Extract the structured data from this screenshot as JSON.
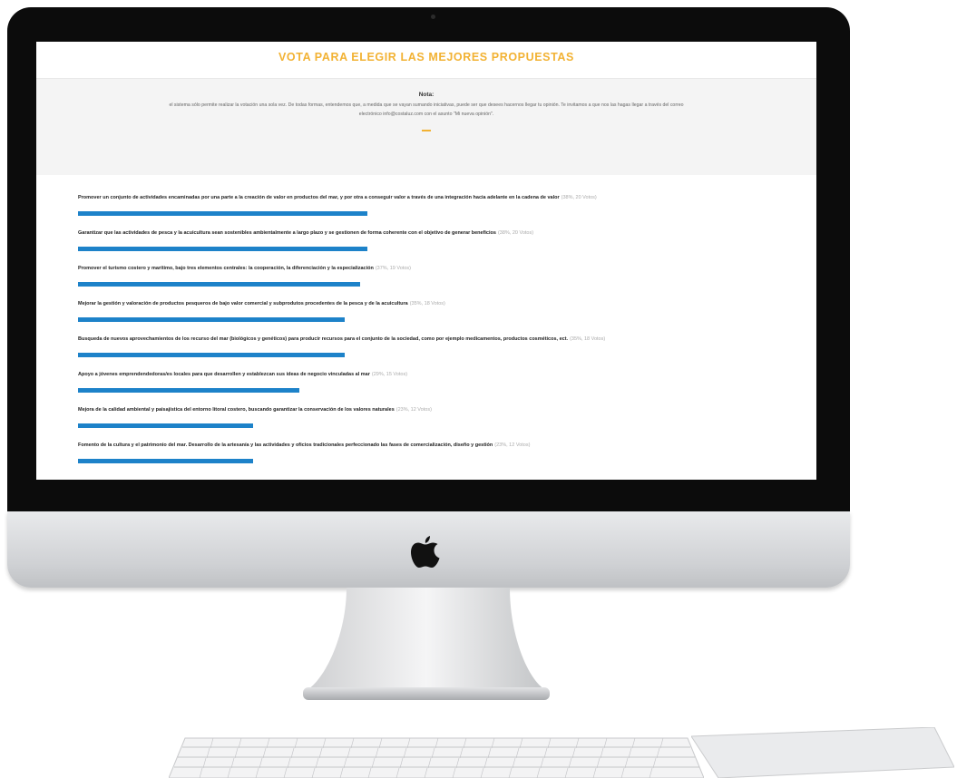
{
  "page": {
    "title": "VOTA PARA ELEGIR LAS MEJORES PROPUESTAS",
    "note": {
      "title": "Nota:",
      "text": "el sistema sólo permite realizar la votación una sola vez. De todas formas, entendemos que, a medida que se vayan sumando iniciativas, puede ser que desees hacernos llegar tu opinión. Te invitamos a que nos las hagas llegar a través del correo electrónico info@costaluz.com con el asunto \"Mi nueva opinión\"."
    }
  },
  "colors": {
    "title_accent": "#f2b233",
    "bar": "#1d82c9",
    "screen_bezel": "#0c0c0c"
  },
  "proposals": [
    {
      "text": "Promover un conjunto de actividades encaminadas por una parte a la creación de valor en productos del mar, y por otra a conseguir valor a través de una integración hacia adelante en la cadena de valor",
      "result": "(38%, 20 Votos)",
      "percent": 38
    },
    {
      "text": "Garantizar que las actividades de pesca y la acuicultura sean sostenibles ambientalmente a largo plazo y se gestionen de forma coherente con el objetivo de generar beneficios",
      "result": "(38%, 20 Votos)",
      "percent": 38
    },
    {
      "text": "Promover el turismo costero y marítimo, bajo tres elementos centrales: la cooperación, la diferenciación y la especialización",
      "result": "(37%, 19 Votos)",
      "percent": 37
    },
    {
      "text": "Mejorar la gestión y valoración de productos pesqueros de bajo valor comercial y subprodutos procedentes de la pesca y de la acuicultura",
      "result": "(35%, 18 Votos)",
      "percent": 35
    },
    {
      "text": "Busqueda de nuevos aprovechamientos de los recurso del mar (biológicos y genéticos) para producir recursos para el conjunto de la sociedad, como por ejemplo medicamentos, productos cosméticos, ect.",
      "result": "(35%, 18 Votos)",
      "percent": 35
    },
    {
      "text": "Apoyo a jóvenes emprendendedoras/es locales para que desarrollen y establezcan sus ideas de negocio vinculadas al mar",
      "result": "(29%, 15 Votos)",
      "percent": 29
    },
    {
      "text": "Mejora de la calidad ambiental y paisajística del entorno litoral costero, buscando garantizar la conservación de los valores naturales",
      "result": "(23%, 12 Votos)",
      "percent": 23
    },
    {
      "text": "Fomento de la cultura y el patrimonio del mar. Desarrollo de la artesanía y las actividades y oficios tradicionales perfeccionado las fases de comercialización, diseño y gestión",
      "result": "(23%, 12 Votos)",
      "percent": 23
    }
  ]
}
